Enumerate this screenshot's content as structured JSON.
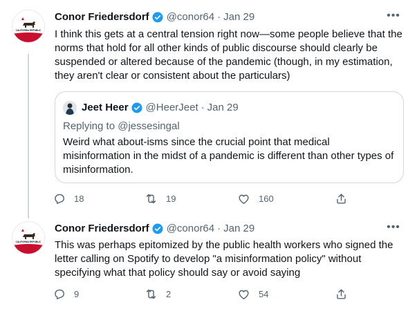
{
  "tweets": [
    {
      "name": "Conor Friedersdorf",
      "handle": "@conor64",
      "separator": "·",
      "date": "Jan 29",
      "text": "I think this gets at a central tension right now—some people believe that the norms that hold for all other kinds of public discourse should clearly be suspended or altered because of the pandemic (though, in my estimation, they aren't clear or consistent about the particulars)",
      "avatar_text": "CALIFORNIA REPUBLIC",
      "quote": {
        "name": "Jeet Heer",
        "handle": "@HeerJeet",
        "separator": "·",
        "date": "Jan 29",
        "replying_to": "Replying to @jessesingal",
        "text": "Weird what about-isms since the crucial point that medical misinformation in the midst of a pandemic is different than other types of misinformation."
      },
      "replies": "18",
      "retweets": "19",
      "likes": "160"
    },
    {
      "name": "Conor Friedersdorf",
      "handle": "@conor64",
      "separator": "·",
      "date": "Jan 29",
      "text": "This was perhaps epitomized by the public health workers who signed the letter calling on Spotify to develop \"a misinformation policy\" without specifying what that policy should say or avoid saying",
      "avatar_text": "CALIFORNIA REPUBLIC",
      "replies": "9",
      "retweets": "2",
      "likes": "54"
    }
  ],
  "colors": {
    "verified": "#1d9bf0",
    "secondary": "#536471",
    "border": "#cfd9de",
    "flag_red": "#c8102e"
  },
  "icons": [
    "verified-badge-icon",
    "more-icon",
    "reply-icon",
    "retweet-icon",
    "like-icon",
    "share-icon"
  ]
}
